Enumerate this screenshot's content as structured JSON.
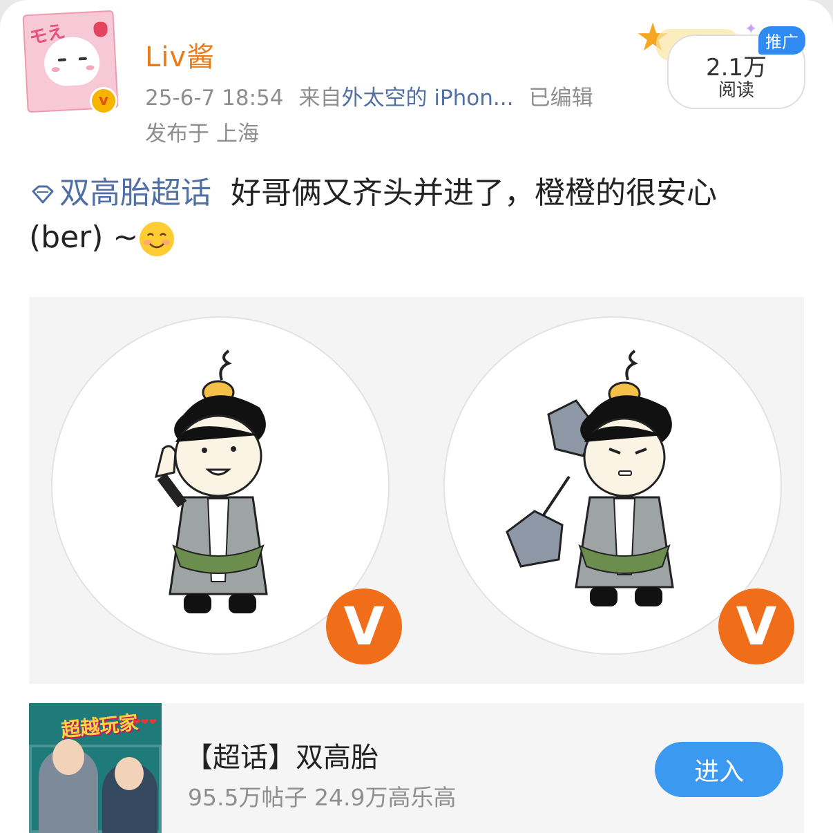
{
  "author": {
    "username": "Liv酱",
    "timestamp": "25-6-7 18:54",
    "source_prefix": "来自",
    "source": "外太空的 iPhon...",
    "edited": "已编辑",
    "location": "发布于 上海",
    "avatar_icon": "cartoon-avatar-icon",
    "verified_icon": "verified-v-icon"
  },
  "promo": {
    "reads": "2.1万",
    "reads_label": "阅读",
    "badge": "推广"
  },
  "post": {
    "topic": "双高胎超话",
    "text_line1": "好哥俩又齐头并进了，橙橙的很安心",
    "text_line2": "(ber) ~",
    "emoji": "smiling-face-emoji"
  },
  "images": {
    "badge_letter": "V",
    "items": [
      {
        "name": "cartoon-thumbs-up",
        "icon": "cartoon-character-thumbs-up"
      },
      {
        "name": "cartoon-hammer",
        "icon": "cartoon-character-hammer"
      }
    ]
  },
  "topic_card": {
    "thumbnail_text": "超越玩家",
    "name": "【超话】双高胎",
    "stats": "95.5万帖子 24.9万高乐高",
    "enter_label": "进入"
  },
  "colors": {
    "username": "#ec7a17",
    "link": "#4f6fa5",
    "meta": "#8e8e8e",
    "badge_orange": "#f06d1a",
    "button_blue": "#3b9af0"
  }
}
